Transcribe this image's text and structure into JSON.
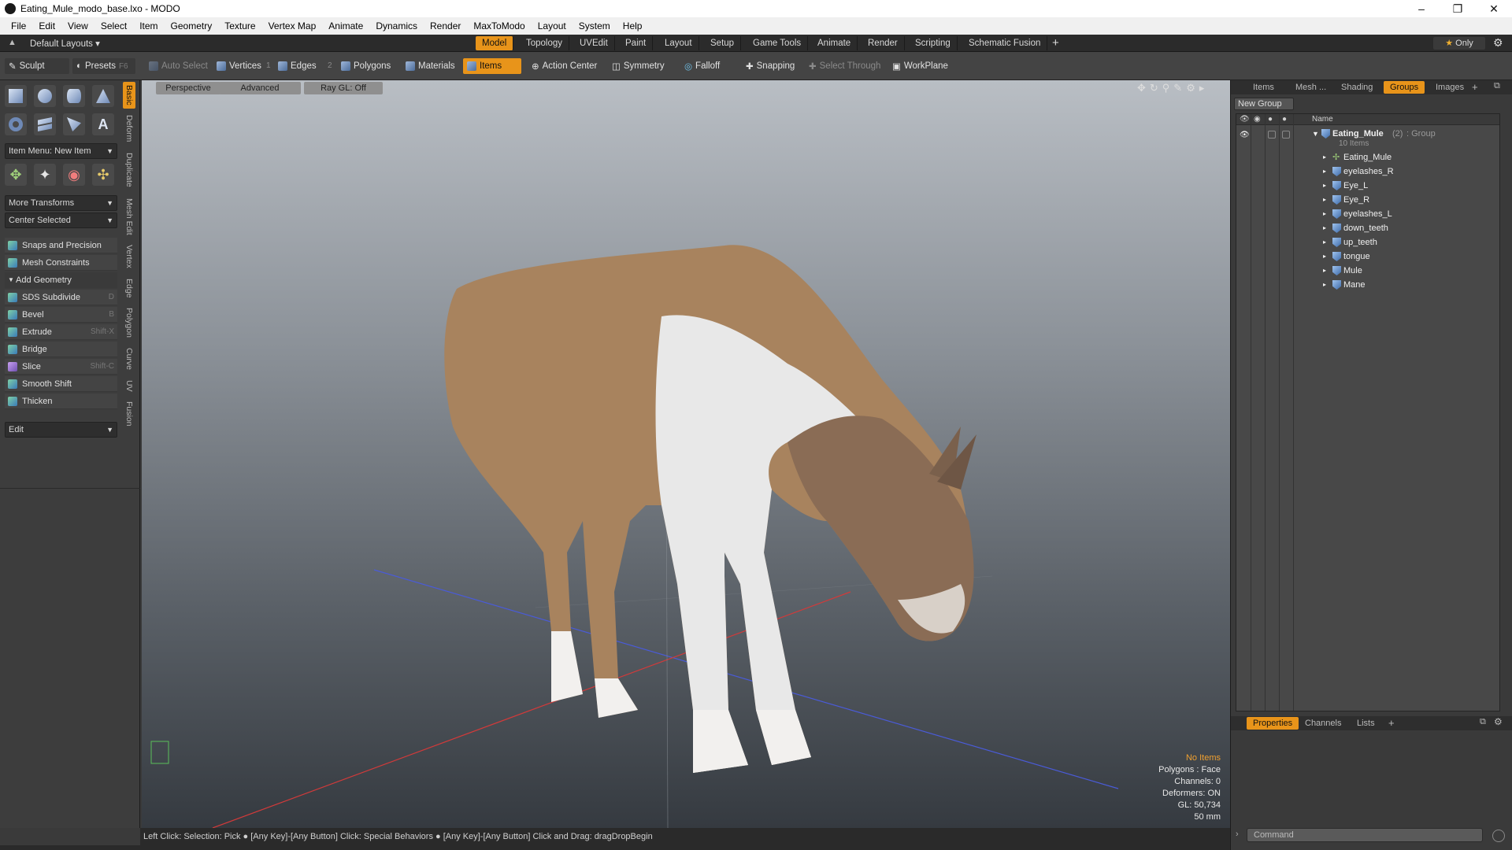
{
  "window": {
    "title": "Eating_Mule_modo_base.lxo - MODO"
  },
  "menu": [
    "File",
    "Edit",
    "View",
    "Select",
    "Item",
    "Geometry",
    "Texture",
    "Vertex Map",
    "Animate",
    "Dynamics",
    "Render",
    "MaxToModo",
    "Layout",
    "System",
    "Help"
  ],
  "layoutbar": {
    "layouts_label": "Default Layouts",
    "tabs": [
      "Model",
      "Topology",
      "UVEdit",
      "Paint",
      "Layout",
      "Setup",
      "Game Tools",
      "Animate",
      "Render",
      "Scripting",
      "Schematic Fusion"
    ],
    "active_tab": "Model",
    "only_label": "Only"
  },
  "toolbar": {
    "sculpt": "Sculpt",
    "presets": "Presets",
    "presets_key": "F6",
    "auto_select": "Auto Select",
    "vertices": "Vertices",
    "vertices_num": "1",
    "edges": "Edges",
    "edges_num": "2",
    "polygons": "Polygons",
    "materials": "Materials",
    "items": "Items",
    "action_center": "Action Center",
    "symmetry": "Symmetry",
    "falloff": "Falloff",
    "snapping": "Snapping",
    "select_through": "Select Through",
    "workplane": "WorkPlane"
  },
  "leftpanel": {
    "item_menu": "Item Menu: New Item",
    "more_transforms": "More Transforms",
    "center_selected": "Center Selected",
    "snaps": "Snaps and Precision",
    "mesh_constraints": "Mesh Constraints",
    "add_geometry": "Add Geometry",
    "tools": [
      {
        "label": "SDS Subdivide",
        "key": "D"
      },
      {
        "label": "Bevel",
        "key": "B"
      },
      {
        "label": "Extrude",
        "key": "Shift-X"
      },
      {
        "label": "Bridge",
        "key": ""
      },
      {
        "label": "Slice",
        "key": "Shift-C"
      },
      {
        "label": "Smooth Shift",
        "key": ""
      },
      {
        "label": "Thicken",
        "key": ""
      }
    ],
    "edit": "Edit",
    "vtabs": [
      "Basic",
      "Deform",
      "Duplicate",
      "Mesh Edit",
      "Vertex",
      "Edge",
      "Polygon",
      "Curve",
      "UV",
      "Fusion"
    ]
  },
  "viewport": {
    "perspective": "Perspective",
    "advanced": "Advanced",
    "raygl": "Ray GL: Off",
    "info": {
      "no_items": "No Items",
      "polygons": "Polygons : Face",
      "channels": "Channels: 0",
      "deformers": "Deformers: ON",
      "gl": "GL: 50,734",
      "scale": "50 mm"
    }
  },
  "statusbar": {
    "text": "Left Click: Selection: Pick ● [Any Key]-[Any Button] Click: Special Behaviors ● [Any Key]-[Any Button] Click and Drag: dragDropBegin"
  },
  "rightpanel": {
    "tabs": [
      "Items",
      "Mesh ...",
      "Shading",
      "Groups",
      "Images"
    ],
    "active_tab": "Groups",
    "new_group": "New Group",
    "col_name": "Name",
    "group": {
      "name": "Eating_Mule",
      "count": "(2)",
      "type": ": Group",
      "items_count": "10 Items"
    },
    "items": [
      "Eating_Mule",
      "eyelashes_R",
      "Eye_L",
      "Eye_R",
      "eyelashes_L",
      "down_teeth",
      "up_teeth",
      "tongue",
      "Mule",
      "Mane"
    ],
    "bottom_tabs": [
      "Properties",
      "Channels",
      "Lists"
    ],
    "bottom_active": "Properties",
    "command_placeholder": "Command"
  }
}
